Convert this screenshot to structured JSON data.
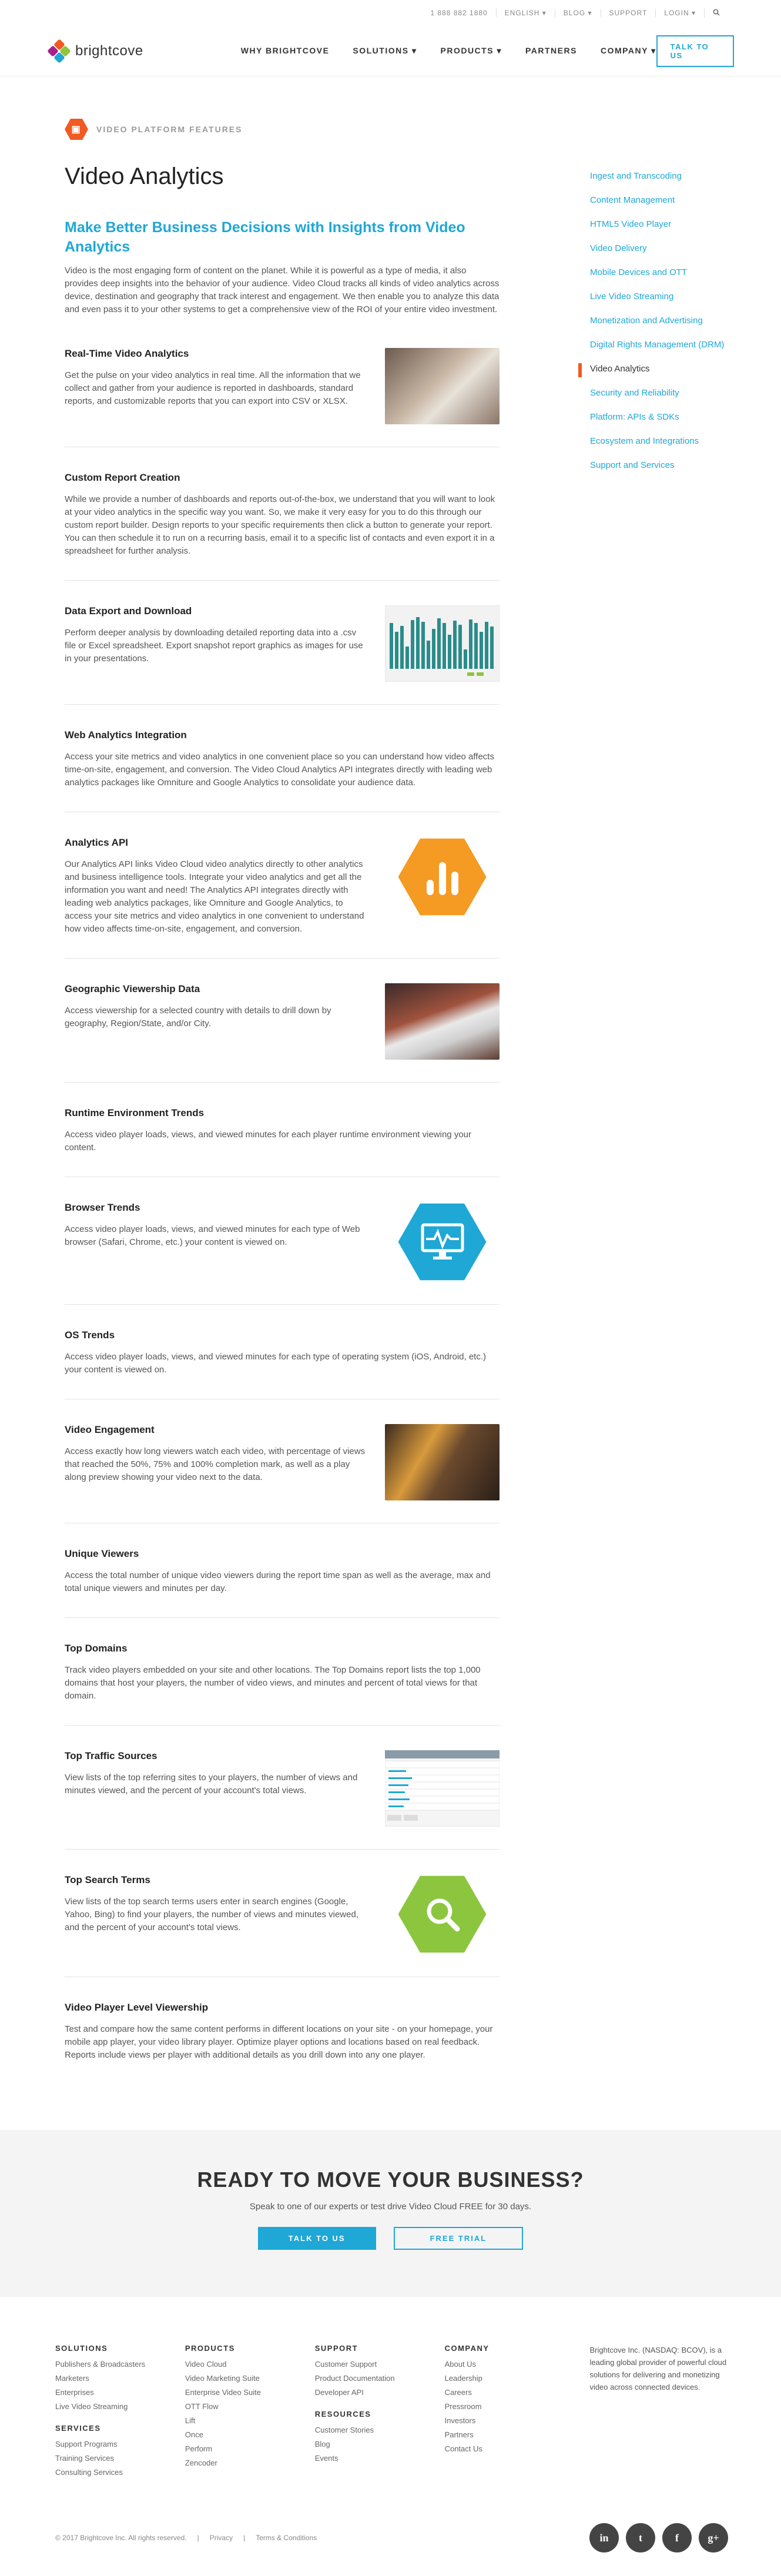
{
  "utility": {
    "phone": "1 888 882 1880",
    "language": "ENGLISH ▾",
    "blog": "BLOG ▾",
    "support": "SUPPORT",
    "login": "LOGIN ▾"
  },
  "nav": {
    "logo": "brightcove",
    "items": [
      "WHY BRIGHTCOVE",
      "SOLUTIONS ▾",
      "PRODUCTS ▾",
      "PARTNERS",
      "COMPANY ▾"
    ],
    "talk": "TALK TO US"
  },
  "hero": {
    "eyebrow": "VIDEO PLATFORM FEATURES",
    "title": "Video Analytics",
    "lead": "Make Better Business Decisions with Insights from Video Analytics",
    "intro": "Video is the most engaging form of content on the planet. While it is powerful as a type of media, it also provides deep insights into the behavior of your audience. Video Cloud tracks all kinds of video analytics across device, destination and geography that track interest and engagement. We then enable you to analyze this data and even pass it to your other systems to get a comprehensive view of the ROI of your entire video investment."
  },
  "features": [
    {
      "title": "Real-Time Video Analytics",
      "body": "Get the pulse on your video analytics in real time. All the information that we collect and gather from your audience is reported in dashboards, standard reports, and customizable reports that you can export into CSV or XLSX."
    },
    {
      "title": "Custom Report Creation",
      "body": "While we provide a number of dashboards and reports out-of-the-box, we understand that you will want to look at your video analytics in the specific way you want. So, we make it very easy for you to do this through our custom report builder. Design reports to your specific requirements then click a button to generate your report. You can then schedule it to run on a recurring basis, email it to a specific list of contacts and even export it in a spreadsheet for further analysis."
    },
    {
      "title": "Data Export and Download",
      "body": "Perform deeper analysis by downloading detailed reporting data into a .csv file or Excel spreadsheet. Export snapshot report graphics as images for use in your presentations."
    },
    {
      "title": "Web Analytics Integration",
      "body": "Access your site metrics and video analytics in one convenient place so you can understand how video affects time-on-site, engagement, and conversion. The Video Cloud Analytics API integrates directly with leading web analytics packages like Omniture and Google Analytics to consolidate your audience data."
    },
    {
      "title": "Analytics API",
      "body": "Our Analytics API links Video Cloud video analytics directly to other analytics and business intelligence tools. Integrate your video analytics and get all the information you want and need! The Analytics API integrates directly with leading web analytics packages, like Omniture and Google Analytics, to access your site metrics and video analytics in one convenient to understand how video affects time-on-site, engagement, and conversion."
    },
    {
      "title": "Geographic Viewership Data",
      "body": "Access viewership for a selected country with details to drill down by geography, Region/State, and/or City."
    },
    {
      "title": "Runtime Environment Trends",
      "body": "Access video player loads, views, and viewed minutes for each player runtime environment viewing your content."
    },
    {
      "title": "Browser Trends",
      "body": "Access video player loads, views, and viewed minutes for each type of Web browser (Safari, Chrome, etc.) your content is viewed on."
    },
    {
      "title": "OS Trends",
      "body": "Access video player loads, views, and viewed minutes for each type of operating system (iOS, Android, etc.) your content is viewed on."
    },
    {
      "title": "Video Engagement",
      "body": "Access exactly how long viewers watch each video, with percentage of views that reached the 50%, 75% and 100% completion mark, as well as a play along preview showing your video next to the data."
    },
    {
      "title": "Unique Viewers",
      "body": "Access the total number of unique video viewers during the report time span as well as the average, max and total unique viewers and minutes per day."
    },
    {
      "title": "Top Domains",
      "body": "Track video players embedded on your site and other locations. The Top Domains report lists the top 1,000 domains that host your players, the number of video views, and minutes and percent of total views for that domain."
    },
    {
      "title": "Top Traffic Sources",
      "body": "View lists of the top referring sites to your players, the number of views and minutes viewed, and the percent of your account's total views."
    },
    {
      "title": "Top Search Terms",
      "body": "View lists of the top search terms users enter in search engines (Google, Yahoo, Bing) to find your players, the number of views and minutes viewed, and the percent of your account's total views."
    },
    {
      "title": "Video Player Level Viewership",
      "body": "Test and compare how the same content performs in different locations on your site - on your homepage, your mobile app player, your video library player. Optimize player options and locations based on real feedback. Reports include views per player with additional details as you drill down into any one player."
    }
  ],
  "sidebar": [
    "Ingest and Transcoding",
    "Content Management",
    "HTML5 Video Player",
    "Video Delivery",
    "Mobile Devices and OTT",
    "Live Video Streaming",
    "Monetization and Advertising",
    "Digital Rights Management (DRM)",
    "Video Analytics",
    "Security and Reliability",
    "Platform: APIs & SDKs",
    "Ecosystem and Integrations",
    "Support and Services"
  ],
  "cta": {
    "title": "READY TO MOVE YOUR BUSINESS?",
    "subtitle": "Speak to one of our experts or test drive Video Cloud FREE for 30 days.",
    "talk": "TALK TO US",
    "trial": "FREE TRIAL"
  },
  "footer": {
    "solutions": {
      "title": "SOLUTIONS",
      "items": [
        "Publishers & Broadcasters",
        "Marketers",
        "Enterprises",
        "Live Video Streaming"
      ]
    },
    "services": {
      "title": "SERVICES",
      "items": [
        "Support Programs",
        "Training Services",
        "Consulting Services"
      ]
    },
    "products": {
      "title": "PRODUCTS",
      "items": [
        "Video Cloud",
        "Video Marketing Suite",
        "Enterprise Video Suite",
        "OTT Flow",
        "Lift",
        "Once",
        "Perform",
        "Zencoder"
      ]
    },
    "support": {
      "title": "SUPPORT",
      "items": [
        "Customer Support",
        "Product Documentation",
        "Developer API"
      ]
    },
    "resources": {
      "title": "RESOURCES",
      "items": [
        "Customer Stories",
        "Blog",
        "Events"
      ]
    },
    "company": {
      "title": "COMPANY",
      "items": [
        "About Us",
        "Leadership",
        "Careers",
        "Pressroom",
        "Investors",
        "Partners",
        "Contact Us"
      ]
    },
    "about": "Brightcove Inc. (NASDAQ: BCOV), is a leading global provider of powerful cloud solutions for delivering and monetizing video across connected devices.",
    "copyright": "© 2017 Brightcove Inc. All rights reserved.",
    "privacy": "Privacy",
    "terms": "Terms & Conditions",
    "social": [
      "in",
      "t",
      "f",
      "g+"
    ]
  },
  "colors": {
    "accent": "#1fa7d6",
    "brand": "#f15a22",
    "api_hex": "#f59a23",
    "browser_hex": "#1fa7d6",
    "search_hex": "#8cc63f"
  }
}
